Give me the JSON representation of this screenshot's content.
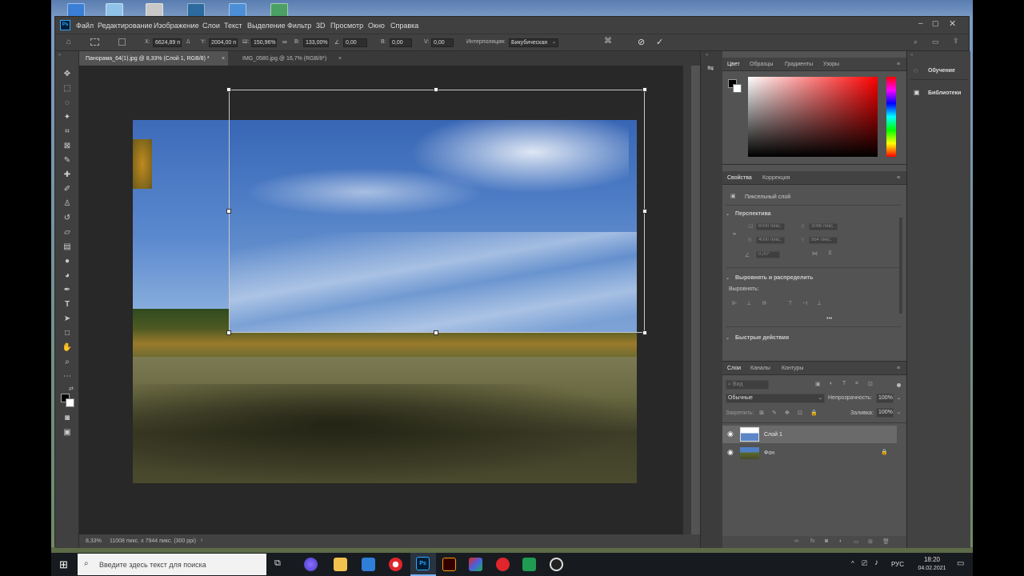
{
  "menu": {
    "app_icon": "Ps",
    "items": [
      "Файл",
      "Редактирование",
      "Изображение",
      "Слои",
      "Текст",
      "Выделение",
      "Фильтр",
      "3D",
      "Просмотр",
      "Окно",
      "Справка"
    ]
  },
  "options": {
    "x_label": "X:",
    "x_value": "6624,89 п",
    "y_label": "Y:",
    "y_value": "2004,00 п",
    "w_label": "Ш:",
    "w_value": "150,96%",
    "link_icon": "link-icon",
    "h_label": "В:",
    "h_value": "133,00%",
    "angle_label": "∠",
    "angle_value": "0,00",
    "skew_h_label": "В:",
    "skew_h_value": "0,00",
    "skew_v_label": "V:",
    "skew_v_value": "0,00",
    "interp_label": "Интерполяция:",
    "interp_value": "Бикубическая",
    "cancel_icon": "cancel-icon",
    "commit_icon": "commit-icon"
  },
  "tabs": [
    {
      "label": "Панорама_64(1).jpg @ 8,33% (Слой 1, RGB/8) *",
      "close": "×"
    },
    {
      "label": "IMG_0580.jpg @ 16,7% (RGB/8*)",
      "close": "×"
    }
  ],
  "status": {
    "zoom": "8,33%",
    "doc_info": "11008 пикс. x 7944 пикс. (300 ppi)",
    "arrow": "›"
  },
  "color_panel": {
    "tabs": [
      "Цвет",
      "Образцы",
      "Градиенты",
      "Узоры"
    ]
  },
  "properties_panel": {
    "tabs": [
      "Свойства",
      "Коррекция"
    ],
    "layer_type": "Пиксельный слой",
    "section_perspective": "Перспектива",
    "w_label": "Ш",
    "w_value": "6000 пикс.",
    "x_label": "X",
    "x_value": "3096 пикс.",
    "h_label": "В",
    "h_value": "4000 пикс.",
    "y_label": "Y",
    "y_value": "664 пикс.",
    "angle_value": "0,00°",
    "section_align": "Выровнять и распределить",
    "align_label": "Выровнять:",
    "more": "•••",
    "section_quick": "Быстрые действия"
  },
  "layers_panel": {
    "tabs": [
      "Слои",
      "Каналы",
      "Контуры"
    ],
    "search_placeholder": "Вид",
    "blend_mode": "Обычные",
    "opacity_label": "Непрозрачность:",
    "opacity_value": "100%",
    "lock_label": "Закрепить:",
    "fill_label": "Заливка:",
    "fill_value": "100%",
    "layers": [
      {
        "name": "Слой 1",
        "selected": true,
        "locked": false
      },
      {
        "name": "Фон",
        "selected": false,
        "locked": true
      }
    ],
    "lock_icon": "🔒"
  },
  "side_panel": {
    "items": [
      "Обучение",
      "Библиотеки"
    ]
  },
  "taskbar": {
    "search_placeholder": "Введите здесь текст для поиска",
    "lang": "РУС",
    "time": "18:20",
    "date": "04.02.2021"
  },
  "colors": {
    "accent_red": "#e5141c",
    "selection": "#6a6a6a"
  }
}
